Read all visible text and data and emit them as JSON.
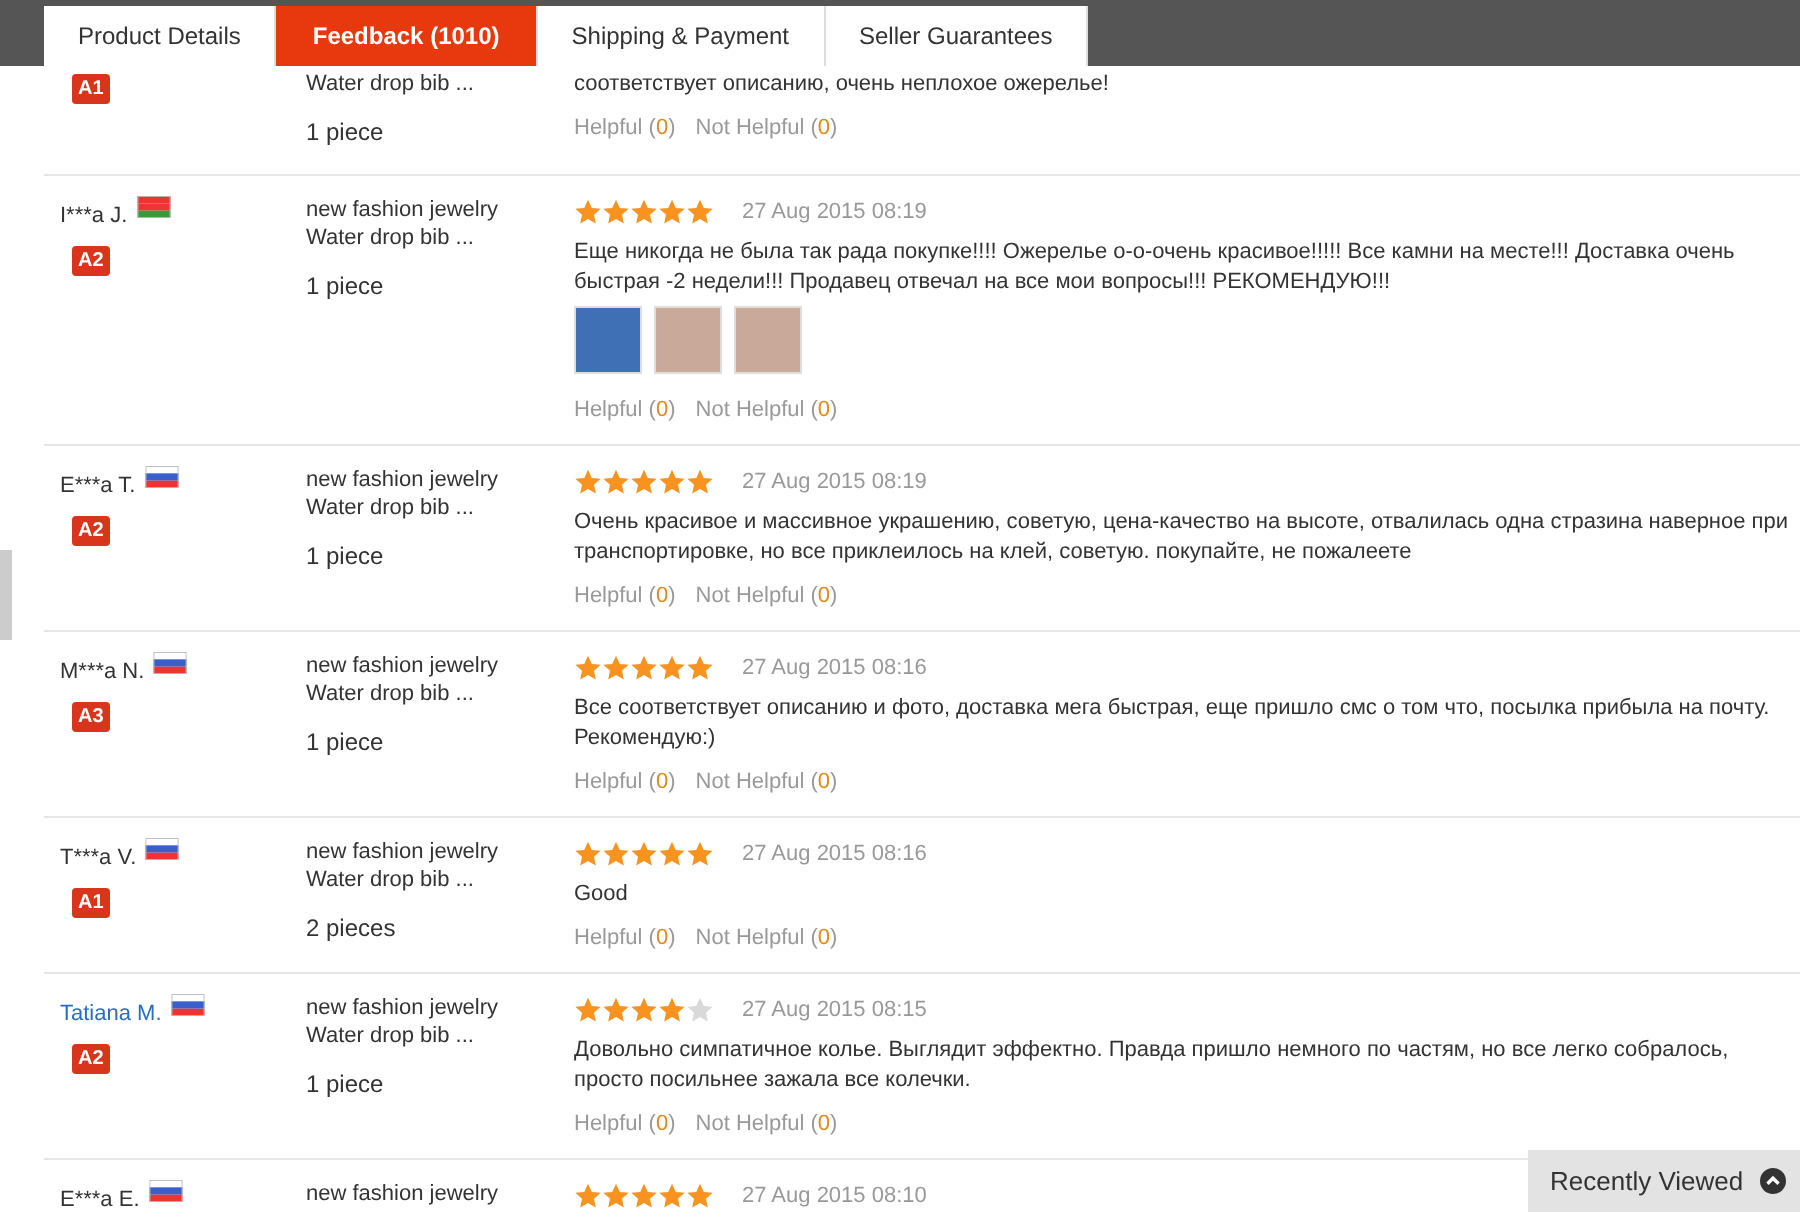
{
  "tabs": [
    {
      "label": "Product Details",
      "selected": false
    },
    {
      "label": "Feedback (1010)",
      "selected": true
    },
    {
      "label": "Shipping & Payment",
      "selected": false
    },
    {
      "label": "Seller Guarantees",
      "selected": false
    }
  ],
  "reviews": [
    {
      "badge": "A1",
      "product": [
        "Water drop bib ..."
      ],
      "quantity": "1 piece",
      "text": "соответствует описанию, очень неплохое ожерелье!",
      "helpful": {
        "label": "Helpful (",
        "count": "0",
        "close": ")"
      },
      "not_helpful": {
        "label": "Not Helpful (",
        "count": "0",
        "close": ")"
      }
    },
    {
      "name": "I***a J.",
      "link": false,
      "flag": {
        "kind": "belarus"
      },
      "badge": "A2",
      "product": [
        "new fashion jewelry",
        "Water drop bib ..."
      ],
      "quantity": "1 piece",
      "stars": 5,
      "date": "27 Aug 2015 08:19",
      "text": "Еще никогда не была так рада покупке!!!! Ожерелье о-о-очень красивое!!!!! Все камни на месте!!! Доставка очень быстрая -2 недели!!! Продавец отвечал на все мои вопросы!!! РЕКОМЕНДУЮ!!!",
      "photos": [
        {
          "kind": "necklace"
        },
        {
          "kind": "person"
        },
        {
          "kind": "person"
        }
      ],
      "helpful": {
        "label": "Helpful (",
        "count": "0",
        "close": ")"
      },
      "not_helpful": {
        "label": "Not Helpful (",
        "count": "0",
        "close": ")"
      }
    },
    {
      "name": "E***a T.",
      "link": false,
      "flag": {
        "kind": "russia"
      },
      "badge": "A2",
      "product": [
        "new fashion jewelry",
        "Water drop bib ..."
      ],
      "quantity": "1 piece",
      "stars": 5,
      "date": "27 Aug 2015 08:19",
      "text": "Очень красивое и массивное украшению, советую, цена-качество на высоте, отвалилась одна стразина наверное при транспортировке, но все приклеилось на клей, советую. покупайте, не пожалеете",
      "helpful": {
        "label": "Helpful (",
        "count": "0",
        "close": ")"
      },
      "not_helpful": {
        "label": "Not Helpful (",
        "count": "0",
        "close": ")"
      }
    },
    {
      "name": "M***a N.",
      "link": false,
      "flag": {
        "kind": "russia"
      },
      "badge": "A3",
      "product": [
        "new fashion jewelry",
        "Water drop bib ..."
      ],
      "quantity": "1 piece",
      "stars": 5,
      "date": "27 Aug 2015 08:16",
      "text": "Все соответствует описанию и фото, доставка мега быстрая, еще пришло смс о том что, посылка прибыла на почту. Рекомендую:)",
      "helpful": {
        "label": "Helpful (",
        "count": "0",
        "close": ")"
      },
      "not_helpful": {
        "label": "Not Helpful (",
        "count": "0",
        "close": ")"
      }
    },
    {
      "name": "T***a V.",
      "link": false,
      "flag": {
        "kind": "russia"
      },
      "badge": "A1",
      "product": [
        "new fashion jewelry",
        "Water drop bib ..."
      ],
      "quantity": "2 pieces",
      "stars": 5,
      "date": "27 Aug 2015 08:16",
      "text": "Good",
      "helpful": {
        "label": "Helpful (",
        "count": "0",
        "close": ")"
      },
      "not_helpful": {
        "label": "Not Helpful (",
        "count": "0",
        "close": ")"
      }
    },
    {
      "name": "Tatiana M.",
      "link": true,
      "flag": {
        "kind": "russia"
      },
      "badge": "A2",
      "product": [
        "new fashion jewelry",
        "Water drop bib ..."
      ],
      "quantity": "1 piece",
      "stars": 4,
      "date": "27 Aug 2015 08:15",
      "text": "Довольно симпатичное колье. Выглядит эффектно. Правда пришло немного по частям, но все легко собралось, просто посильнее зажала все колечки.",
      "helpful": {
        "label": "Helpful (",
        "count": "0",
        "close": ")"
      },
      "not_helpful": {
        "label": "Not Helpful (",
        "count": "0",
        "close": ")"
      }
    },
    {
      "name": "E***a E.",
      "link": false,
      "flag": {
        "kind": "russia"
      },
      "product": [
        "new fashion jewelry"
      ],
      "stars": 5,
      "date": "27 Aug 2015 08:10"
    }
  ],
  "recently_viewed": {
    "label": "Recently Viewed"
  }
}
